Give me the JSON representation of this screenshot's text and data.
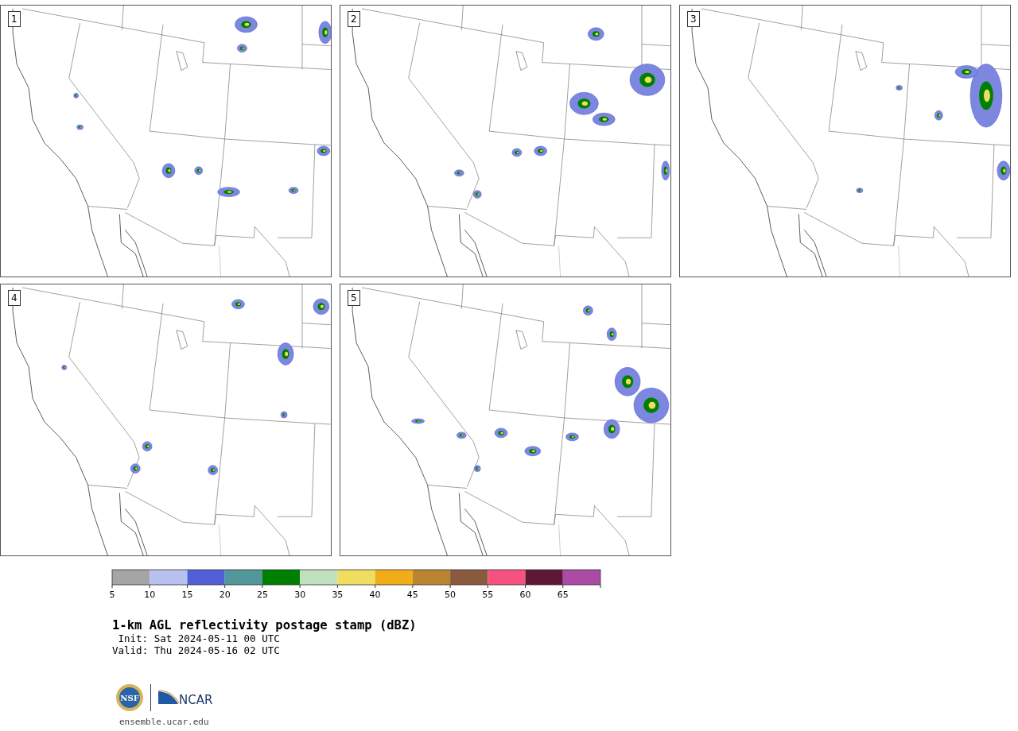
{
  "panels": [
    {
      "number": "1"
    },
    {
      "number": "2"
    },
    {
      "number": "3"
    },
    {
      "number": "4"
    },
    {
      "number": "5"
    }
  ],
  "colorbar": {
    "bins": [
      {
        "color": "#a5a5a5",
        "label": "5"
      },
      {
        "color": "#b8c2ee",
        "label": "10"
      },
      {
        "color": "#525fd6",
        "label": "15"
      },
      {
        "color": "#52979a",
        "label": "20"
      },
      {
        "color": "#008000",
        "label": "25"
      },
      {
        "color": "#bfdfbf",
        "label": "30"
      },
      {
        "color": "#f0dc5e",
        "label": "35"
      },
      {
        "color": "#f0ad18",
        "label": "40"
      },
      {
        "color": "#bb8432",
        "label": "45"
      },
      {
        "color": "#8a5a3e",
        "label": "50"
      },
      {
        "color": "#f5527f",
        "label": "55"
      },
      {
        "color": "#5f1737",
        "label": "60"
      },
      {
        "color": "#ab4ba5",
        "label": "65"
      }
    ]
  },
  "title": "1-km AGL reflectivity postage stamp (dBZ)",
  "init": "Init: Sat 2024-05-11 00 UTC",
  "valid": "Valid: Thu 2024-05-16 02 UTC",
  "logo": {
    "nsf_text": "NSF",
    "ncar_text": "NCAR"
  },
  "site": "ensemble.ucar.edu"
}
